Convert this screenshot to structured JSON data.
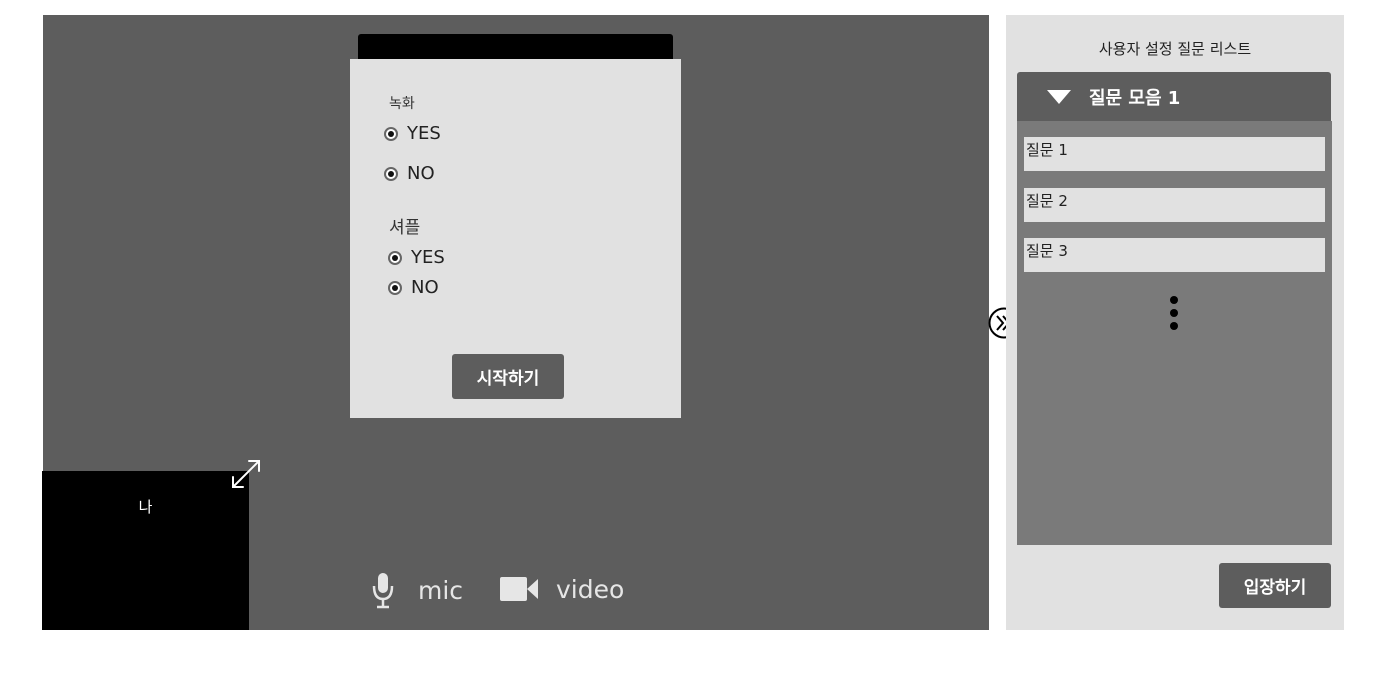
{
  "settings": {
    "recording": {
      "label": "녹화",
      "options": [
        "YES",
        "NO"
      ]
    },
    "shuffle": {
      "label": "셔플",
      "options": [
        "YES",
        "NO"
      ]
    },
    "start_label": "시작하기"
  },
  "self_view": {
    "label": "나"
  },
  "controls": {
    "mic_label": "mic",
    "video_label": "video"
  },
  "panel": {
    "title": "사용자 설정 질문 리스트",
    "group": {
      "title": "질문 모음 1",
      "questions": [
        "질문 1",
        "질문 2",
        "질문 3"
      ]
    },
    "enter_label": "입장하기"
  },
  "icons": {
    "expand": "expand-icon",
    "mic": "mic-icon",
    "video": "video-camera-icon",
    "toggle": "double-chevron-right-icon",
    "more": "vertical-ellipsis-icon",
    "collapse": "triangle-down-icon"
  },
  "colors": {
    "stage": "#5d5d5d",
    "panel": "#e1e1e1",
    "button": "#5d5d5d",
    "list_body": "#7a7a7a"
  }
}
